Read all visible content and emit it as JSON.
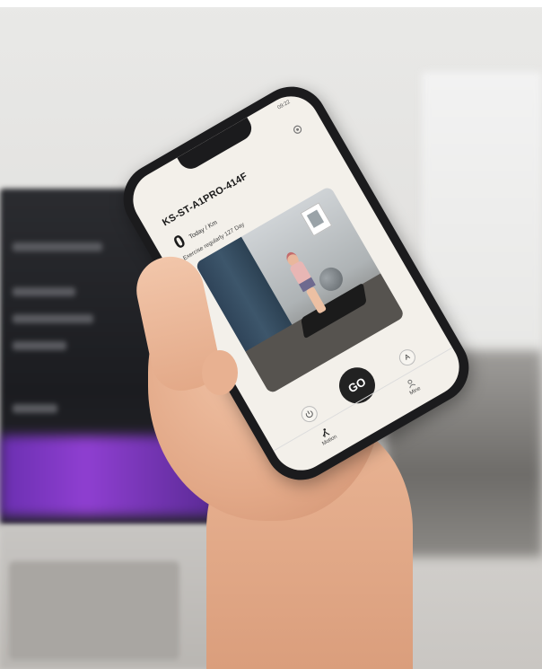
{
  "phone": {
    "status_time": "09:22",
    "device_name": "KS-ST-A1PRO-414F",
    "today_value": "0",
    "today_unit": "Today / Km",
    "exercise_text": "Exercise regularly 127 Day",
    "go_label": "GO",
    "auto_label": "A",
    "tabs": [
      {
        "label": "Motion",
        "icon": "run-icon"
      },
      {
        "label": "Mine",
        "icon": "person-icon"
      }
    ]
  },
  "colors": {
    "screen_bg": "#f3f0ea",
    "phone_frame": "#1b1b1d",
    "go_button": "#222222",
    "skin": "#e6ab8b"
  }
}
